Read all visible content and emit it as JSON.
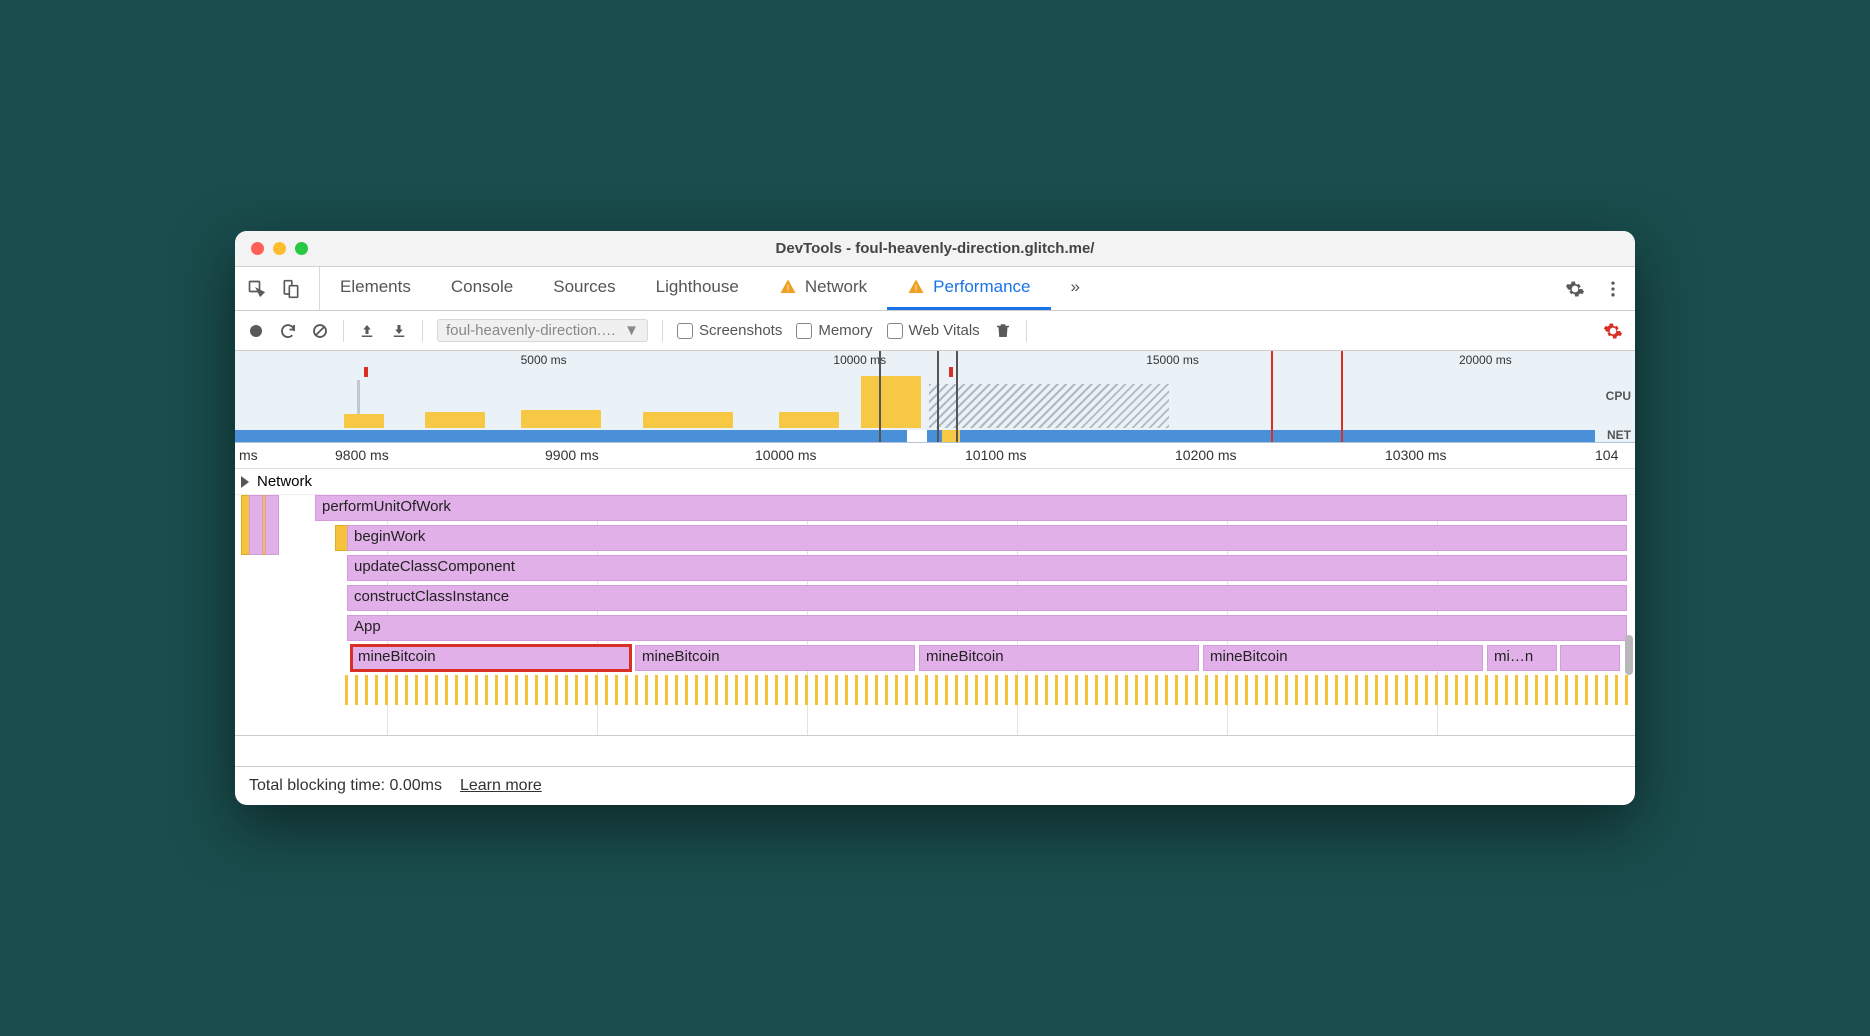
{
  "window": {
    "title": "DevTools - foul-heavenly-direction.glitch.me/"
  },
  "tabs": {
    "items": [
      {
        "label": "Elements"
      },
      {
        "label": "Console"
      },
      {
        "label": "Sources"
      },
      {
        "label": "Lighthouse"
      },
      {
        "label": "Network",
        "warning": true
      },
      {
        "label": "Performance",
        "warning": true,
        "active": true
      }
    ]
  },
  "toolbar": {
    "profile": "foul-heavenly-direction.…",
    "checkboxes": {
      "screenshots": "Screenshots",
      "memory": "Memory",
      "vitals": "Web Vitals"
    }
  },
  "overview": {
    "ticks": [
      "5000 ms",
      "10000 ms",
      "15000 ms",
      "20000 ms"
    ],
    "labels": {
      "cpu": "CPU",
      "net": "NET"
    }
  },
  "ruler": {
    "start": "ms",
    "ticks": [
      "9800 ms",
      "9900 ms",
      "10000 ms",
      "10100 ms",
      "10200 ms",
      "10300 ms",
      "104"
    ]
  },
  "network_section": {
    "label": "Network"
  },
  "flame": {
    "rows": [
      {
        "label": "performUnitOfWork"
      },
      {
        "label": "beginWork"
      },
      {
        "label": "updateClassComponent"
      },
      {
        "label": "constructClassInstance"
      },
      {
        "label": "App"
      }
    ],
    "mine": {
      "b0": "mineBitcoin",
      "b1": "mineBitcoin",
      "b2": "mineBitcoin",
      "b3": "mineBitcoin",
      "b4": "mi…n"
    }
  },
  "footer": {
    "tbt": "Total blocking time: 0.00ms",
    "learn": "Learn more"
  }
}
